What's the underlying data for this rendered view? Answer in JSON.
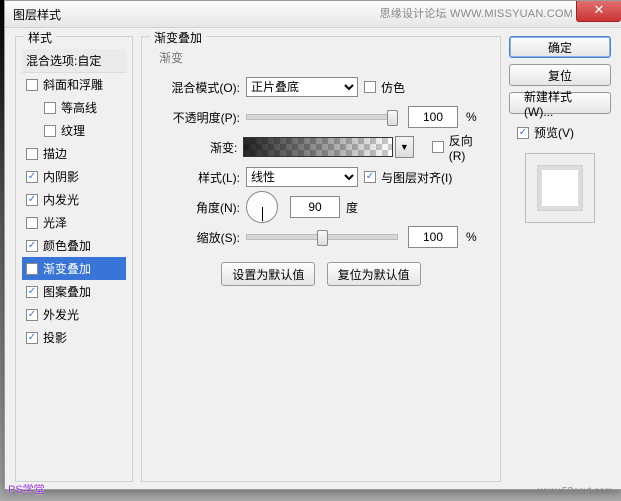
{
  "title": "图层样式",
  "watermarks": {
    "top": "思缘设计论坛  WWW.MISSYUAN.COM",
    "bl": "PS学堂",
    "br": "www.52psxt.com"
  },
  "stylesPanel": {
    "label": "样式",
    "header": "混合选项:自定",
    "items": [
      {
        "label": "斜面和浮雕",
        "checked": false,
        "indent": false
      },
      {
        "label": "等高线",
        "checked": false,
        "indent": true
      },
      {
        "label": "纹理",
        "checked": false,
        "indent": true
      },
      {
        "label": "描边",
        "checked": false,
        "indent": false
      },
      {
        "label": "内阴影",
        "checked": true,
        "indent": false
      },
      {
        "label": "内发光",
        "checked": true,
        "indent": false
      },
      {
        "label": "光泽",
        "checked": false,
        "indent": false
      },
      {
        "label": "颜色叠加",
        "checked": true,
        "indent": false
      },
      {
        "label": "渐变叠加",
        "checked": true,
        "indent": false,
        "selected": true
      },
      {
        "label": "图案叠加",
        "checked": true,
        "indent": false
      },
      {
        "label": "外发光",
        "checked": true,
        "indent": false
      },
      {
        "label": "投影",
        "checked": true,
        "indent": false
      }
    ]
  },
  "content": {
    "group": "渐变叠加",
    "section": "渐变",
    "rows": {
      "blendMode": {
        "label": "混合模式(O):",
        "value": "正片叠底",
        "extra": "仿色"
      },
      "opacity": {
        "label": "不透明度(P):",
        "value": "100",
        "unit": "%"
      },
      "gradient": {
        "label": "渐变:",
        "reverse": "反向(R)"
      },
      "style": {
        "label": "样式(L):",
        "value": "线性",
        "align": "与图层对齐(I)"
      },
      "angle": {
        "label": "角度(N):",
        "value": "90",
        "unit": "度"
      },
      "scale": {
        "label": "缩放(S):",
        "value": "100",
        "unit": "%"
      }
    },
    "reset": {
      "setDefault": "设置为默认值",
      "resetDefault": "复位为默认值"
    }
  },
  "side": {
    "ok": "确定",
    "cancel": "复位",
    "newStyle": "新建样式(W)...",
    "preview": "预览(V)"
  }
}
